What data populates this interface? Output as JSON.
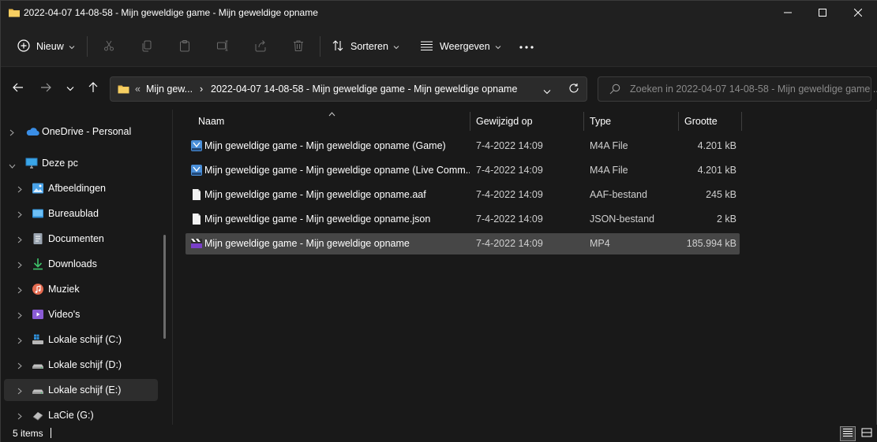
{
  "window": {
    "title": "2022-04-07 14-08-58 - Mijn geweldige game - Mijn geweldige opname",
    "controls": [
      "minimize-icon",
      "maximize-icon",
      "close-icon"
    ]
  },
  "toolbar": {
    "new_label": "Nieuw",
    "sort_label": "Sorteren",
    "view_label": "Weergeven",
    "icons": [
      "cut-icon",
      "copy-icon",
      "paste-icon",
      "rename-icon",
      "share-icon",
      "delete-icon"
    ]
  },
  "address": {
    "overflow": "«",
    "crumb1": "Mijn gew...",
    "separator": "›",
    "crumb2": "2022-04-07 14-08-58 - Mijn geweldige game - Mijn geweldige opname"
  },
  "search": {
    "placeholder": "Zoeken in 2022-04-07 14-08-58 - Mijn geweldige game ..."
  },
  "sidebar": {
    "items": [
      {
        "label": "OneDrive - Personal",
        "icon": "cloud-icon",
        "expanded": false
      },
      {
        "label": "Deze pc",
        "icon": "computer-icon",
        "expanded": true
      },
      {
        "label": "Afbeeldingen",
        "icon": "pictures-icon"
      },
      {
        "label": "Bureaublad",
        "icon": "desktop-icon"
      },
      {
        "label": "Documenten",
        "icon": "documents-icon"
      },
      {
        "label": "Downloads",
        "icon": "download-icon"
      },
      {
        "label": "Muziek",
        "icon": "music-icon"
      },
      {
        "label": "Video's",
        "icon": "videos-icon"
      },
      {
        "label": "Lokale schijf (C:)",
        "icon": "system-drive-icon"
      },
      {
        "label": "Lokale schijf (D:)",
        "icon": "drive-icon"
      },
      {
        "label": "Lokale schijf (E:)",
        "icon": "drive-icon",
        "selected": true
      },
      {
        "label": "LaCie (G:)",
        "icon": "external-drive-icon"
      }
    ]
  },
  "columns": {
    "name": "Naam",
    "modified": "Gewijzigd op",
    "type": "Type",
    "size": "Grootte",
    "sort_indicator": "^"
  },
  "files": [
    {
      "name": "Mijn geweldige game - Mijn geweldige opname (Game)",
      "modified": "7-4-2022 14:09",
      "type": "M4A File",
      "size": "4.201 kB",
      "icon": "m4a-file-icon"
    },
    {
      "name": "Mijn geweldige game - Mijn geweldige opname (Live Comm...",
      "modified": "7-4-2022 14:09",
      "type": "M4A File",
      "size": "4.201 kB",
      "icon": "m4a-file-icon"
    },
    {
      "name": "Mijn geweldige game - Mijn geweldige opname.aaf",
      "modified": "7-4-2022 14:09",
      "type": "AAF-bestand",
      "size": "245 kB",
      "icon": "document-file-icon"
    },
    {
      "name": "Mijn geweldige game - Mijn geweldige opname.json",
      "modified": "7-4-2022 14:09",
      "type": "JSON-bestand",
      "size": "2 kB",
      "icon": "document-file-icon"
    },
    {
      "name": "Mijn geweldige game - Mijn geweldige opname",
      "modified": "7-4-2022 14:09",
      "type": "MP4",
      "size": "185.994 kB",
      "icon": "mp4-file-icon",
      "selected": true
    }
  ],
  "status": {
    "count": "5 items"
  },
  "colors": {
    "accent_folder": "#f2c55c",
    "selection": "#464646",
    "background": "#191919"
  }
}
